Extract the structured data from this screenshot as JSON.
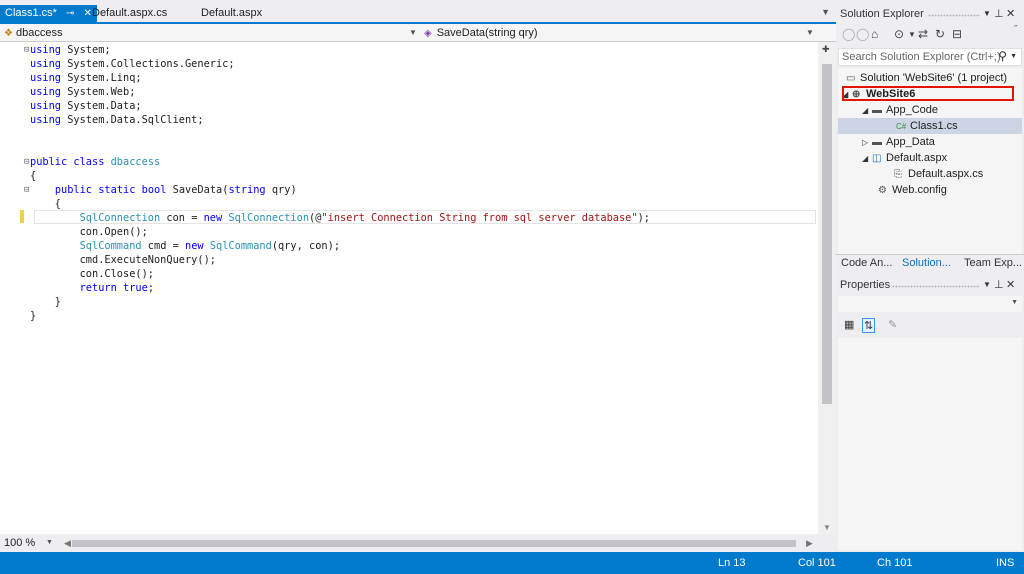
{
  "tabs": [
    {
      "label": "Class1.cs*",
      "active": true,
      "pin": "⊸",
      "close": "✕"
    },
    {
      "label": "Default.aspx.cs",
      "active": false
    },
    {
      "label": "Default.aspx",
      "active": false
    }
  ],
  "navbar": {
    "left": "dbaccess",
    "right": "SaveData(string qry)"
  },
  "code_lines": [
    [
      [
        "kw",
        "using"
      ],
      [
        "pl",
        " System;"
      ]
    ],
    [
      [
        "kw",
        "using"
      ],
      [
        "pl",
        " System.Collections.Generic;"
      ]
    ],
    [
      [
        "kw",
        "using"
      ],
      [
        "pl",
        " System.Linq;"
      ]
    ],
    [
      [
        "kw",
        "using"
      ],
      [
        "pl",
        " System.Web;"
      ]
    ],
    [
      [
        "kw",
        "using"
      ],
      [
        "pl",
        " System.Data;"
      ]
    ],
    [
      [
        "kw",
        "using"
      ],
      [
        "pl",
        " System.Data.SqlClient;"
      ]
    ],
    [],
    [],
    [
      [
        "kw",
        "public"
      ],
      [
        "pl",
        " "
      ],
      [
        "kw",
        "class"
      ],
      [
        "pl",
        " "
      ],
      [
        "ty",
        "dbaccess"
      ]
    ],
    [
      [
        "pl",
        "{"
      ]
    ],
    [
      [
        "pl",
        "    "
      ],
      [
        "kw",
        "public"
      ],
      [
        "pl",
        " "
      ],
      [
        "kw",
        "static"
      ],
      [
        "pl",
        " "
      ],
      [
        "kw",
        "bool"
      ],
      [
        "pl",
        " SaveData("
      ],
      [
        "kw",
        "string"
      ],
      [
        "pl",
        " qry)"
      ]
    ],
    [
      [
        "pl",
        "    {"
      ]
    ],
    [
      [
        "pl",
        "        "
      ],
      [
        "ty",
        "SqlConnection"
      ],
      [
        "pl",
        " con = "
      ],
      [
        "kw",
        "new"
      ],
      [
        "pl",
        " "
      ],
      [
        "ty",
        "SqlConnection"
      ],
      [
        "pl",
        "(@"
      ],
      [
        "st",
        "\"insert Connection String from sql server database\""
      ],
      [
        "pl",
        ");"
      ]
    ],
    [
      [
        "pl",
        "        con.Open();"
      ]
    ],
    [
      [
        "pl",
        "        "
      ],
      [
        "ty",
        "SqlCommand"
      ],
      [
        "pl",
        " cmd = "
      ],
      [
        "kw",
        "new"
      ],
      [
        "pl",
        " "
      ],
      [
        "ty",
        "SqlCommand"
      ],
      [
        "pl",
        "(qry, con);"
      ]
    ],
    [
      [
        "pl",
        "        cmd.ExecuteNonQuery();"
      ]
    ],
    [
      [
        "pl",
        "        con.Close();"
      ]
    ],
    [
      [
        "pl",
        "        "
      ],
      [
        "kw",
        "return"
      ],
      [
        "pl",
        " "
      ],
      [
        "kw",
        "true"
      ],
      [
        "pl",
        ";"
      ]
    ],
    [
      [
        "pl",
        "    }"
      ]
    ],
    [
      [
        "pl",
        "}"
      ]
    ]
  ],
  "editor": {
    "zoom": "100 %"
  },
  "status": {
    "line": "Ln 13",
    "col": "Col 101",
    "ch": "Ch 101",
    "mode": "INS"
  },
  "solution_explorer": {
    "title": "Solution Explorer",
    "search_placeholder": "Search Solution Explorer (Ctrl+;)",
    "tree": [
      {
        "label": "Solution 'WebSite6' (1 project)",
        "icon": "solution-icon"
      },
      {
        "label": "WebSite6",
        "icon": "website-icon",
        "bold": true
      },
      {
        "label": "App_Code",
        "icon": "folder-icon"
      },
      {
        "label": "Class1.cs",
        "icon": "csharp-file-icon",
        "selected": true
      },
      {
        "label": "App_Data",
        "icon": "folder-icon"
      },
      {
        "label": "Default.aspx",
        "icon": "aspx-page-icon"
      },
      {
        "label": "Default.aspx.cs",
        "icon": "cs-codebehind-icon"
      },
      {
        "label": "Web.config",
        "icon": "config-icon"
      }
    ],
    "bottom_tabs": [
      "Code An...",
      "Solution...",
      "Team Exp..."
    ]
  },
  "properties": {
    "title": "Properties"
  },
  "colors": {
    "accent": "#007acc",
    "keyword": "#0000ff",
    "type": "#2b91af",
    "string": "#a31515",
    "highlight_box": "#e51400"
  }
}
